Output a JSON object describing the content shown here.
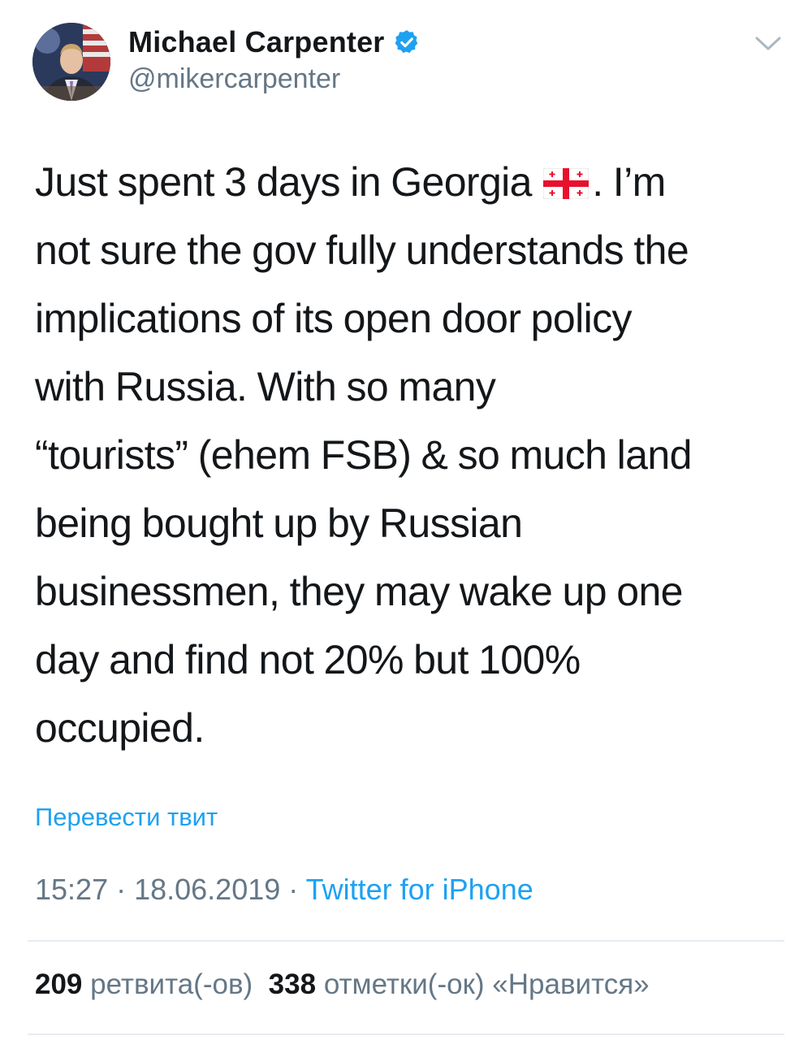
{
  "user": {
    "display_name": "Michael Carpenter",
    "handle": "@mikercarpenter",
    "verified": true,
    "avatar": "profile-photo"
  },
  "tweet": {
    "lines": [
      "Just spent 3 days in Georgia",
      "not sure the gov fully understands the",
      "implications of its open door policy",
      "with Russia. With so many",
      "“tourists” (ehem FSB) & so much land",
      "being bought up by Russian",
      "businessmen, they may wake up one",
      "day and find not 20% but 100%",
      "occupied."
    ],
    "line1_after_flag": ". I’m",
    "emoji": "georgia-flag"
  },
  "translate_label": "Перевести твит",
  "meta": {
    "time": "15:27",
    "separator": " · ",
    "date": "18.06.2019",
    "source": "Twitter for iPhone"
  },
  "stats": {
    "retweets_count": "209",
    "retweets_label": "ретвита(-ов)",
    "likes_count": "338",
    "likes_label": "отметки(-ок) «Нравится»"
  },
  "colors": {
    "link": "#1da1f2",
    "secondary_text": "#657786",
    "primary_text": "#14171a",
    "divider": "#e6ecf0"
  },
  "icons": [
    "verified-badge-icon",
    "chevron-down-icon",
    "georgia-flag-icon"
  ]
}
